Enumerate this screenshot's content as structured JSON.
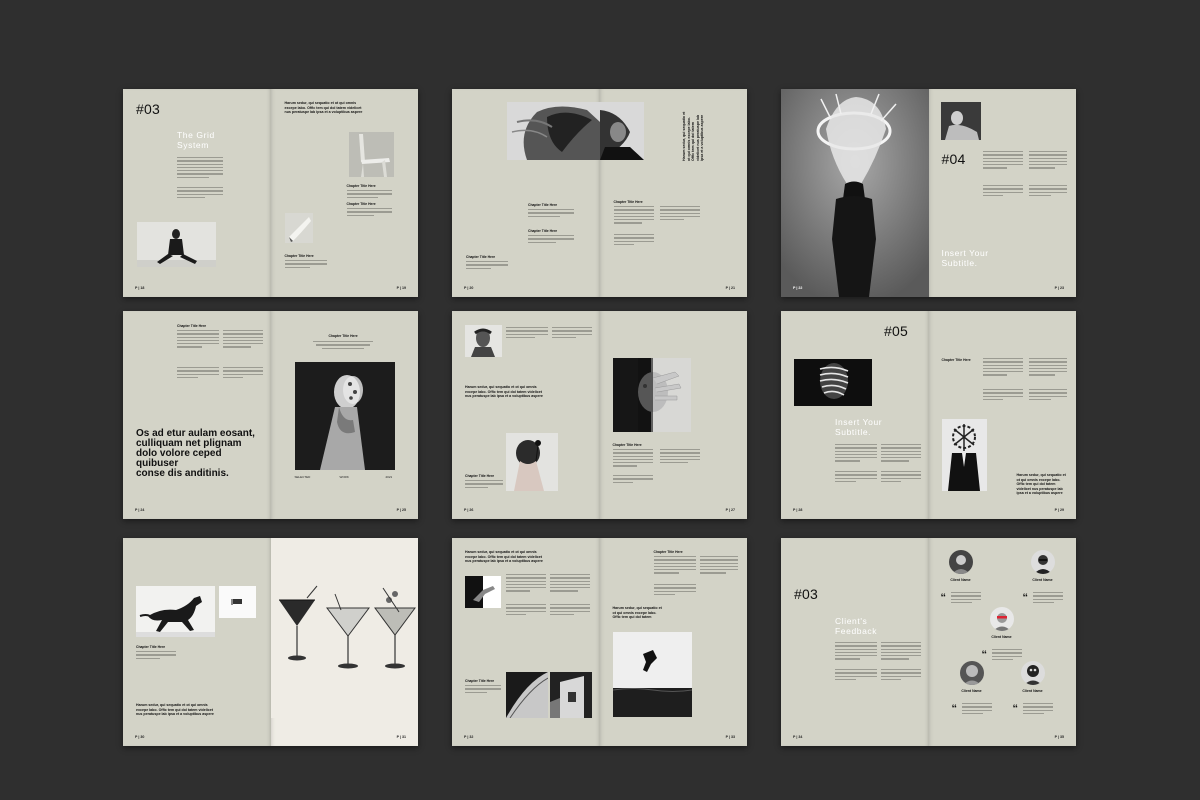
{
  "s1": {
    "num": "#03",
    "title1": "The Grid",
    "title2": "System",
    "pn_l": "P | 18",
    "pn_r": "P | 19",
    "heads": [
      "Chapter Title Here",
      "Chapter Title Here",
      "Chapter Title Here"
    ],
    "bq": "Harum sedur, qui sequatio et ot qui omnis excepe labo. Offic tem qui dol tatem videlicet nus peratuspe lab ipsa et a voluptibus aspere"
  },
  "s2": {
    "pn_l": "P | 20",
    "pn_r": "P | 21",
    "heads": [
      "Chapter Title Here",
      "Chapter Title Here",
      "Chapter Title Here",
      "Chapter Title Here"
    ],
    "bq": "Harum sedur, qui sequatio et ot qui omnis excepe labo. Offic tem qui dol tatem videlicet nus peratuspe lab ipsa et a voluptibus aspere"
  },
  "s3": {
    "num": "#04",
    "subtitle1": "Insert Your",
    "subtitle2": "Subtitle.",
    "pn_l": "P | 22",
    "pn_r": "P | 23"
  },
  "s4": {
    "quote": "Os ad etur aulam eosant,\nculliquam net plignam\ndolo volore ceped quibuser\nconse dis anditinis.",
    "head": "Chapter Title Here",
    "head2": "Chapter Title Here",
    "cap1": "SELECTED",
    "cap2": "WORK",
    "cap3": "2021",
    "pn_l": "P | 24",
    "pn_r": "P | 25"
  },
  "s5": {
    "bq": "Harum sedur, qui sequatio et ot qui omnis excepe labo. Offic tem qui dol tatem videlicet nus peratuspe lab ipsa et a voluptibus aspere",
    "heads": [
      "Chapter Title Here",
      "Chapter Title Here"
    ],
    "pn_l": "P | 26",
    "pn_r": "P | 27"
  },
  "s6": {
    "num": "#05",
    "subtitle1": "Insert Your",
    "subtitle2": "Subtitle.",
    "head": "Chapter Title Here",
    "bq": "Harum sedur, qui sequatio et ot qui omnis excepe labo. Offic tem qui dol tatem videlicet nus peratuspe lab ipsa et a voluptibus aspere",
    "pn_l": "P | 28",
    "pn_r": "P | 29"
  },
  "s7": {
    "head": "Chapter Title Here",
    "bq": "Harum sedur, qui sequatio et ot qui omnis excepe labo. Offic tem qui dol tatem videlicet nus peratuspe lab ipsa et a voluptibus aspere",
    "pn_l": "P | 30",
    "pn_r": "P | 31"
  },
  "s8": {
    "bq": "Harum sedur, qui sequatio et ot qui omnis excepe labo. Offic tem qui dol tatem videlicet nus peratuspe lab ipsa et a voluptibus aspere",
    "bq2": "Harum sedur, qui sequatio et ot qui omnis excepe labo. Offic tem qui dol tatem",
    "heads": [
      "Chapter Title Here",
      "Chapter Title Here"
    ],
    "pn_l": "P | 32",
    "pn_r": "P | 33"
  },
  "s9": {
    "num": "#03",
    "title1": "Client's",
    "title2": "Feedback",
    "names": [
      "Client Name",
      "Client Name",
      "Client Name",
      "Client Name",
      "Client Name"
    ],
    "pn_l": "P | 34",
    "pn_r": "P | 35"
  }
}
